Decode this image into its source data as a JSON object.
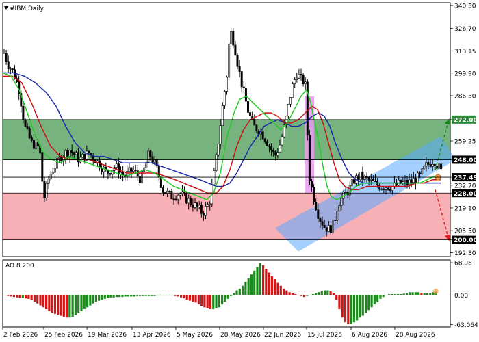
{
  "chart_title": "#IBM,Daily",
  "ao_label": "AO 8.200",
  "colors": {
    "grid_line": "#000000",
    "green_zone": "#2e8b3a",
    "red_zone": "#f47c87",
    "channel": "#5aa9ff",
    "pink_bar": "#e79bf0",
    "ma_fast": "#22cc22",
    "ma_mid": "#cc1111",
    "ma_slow": "#1c2aa8",
    "ao_up": "#1a8a1a",
    "ao_down": "#d41515",
    "arrow_up": "#1a8a1a",
    "arrow_down": "#e02020"
  },
  "chart_data": [
    {
      "type": "candlestick",
      "title": "#IBM,Daily",
      "x_ticks": [
        "2 Feb 2026",
        "25 Feb 2026",
        "19 Mar 2026",
        "13 Apr 2026",
        "5 May 2026",
        "28 May 2026",
        "22 Jun 2026",
        "15 Jul 2026",
        "6 Aug 2026",
        "28 Aug 2026"
      ],
      "y_ticks": [
        "340.30",
        "326.70",
        "313.15",
        "299.90",
        "286.30",
        "272.00",
        "259.25",
        "248.00",
        "237.49",
        "232.70",
        "228.00",
        "219.10",
        "205.50",
        "200.00",
        "192.30"
      ],
      "ylim": [
        190,
        342
      ],
      "levels": [
        {
          "label": "272.00",
          "value": 272.0,
          "style": "green"
        },
        {
          "label": "248.00",
          "value": 248.0,
          "style": "dark"
        },
        {
          "label": "237.49",
          "value": 237.49,
          "style": "dark"
        },
        {
          "label": "228.00",
          "value": 228.0,
          "style": "dark"
        },
        {
          "label": "200.00",
          "value": 200.0,
          "style": "dark"
        }
      ],
      "zones": {
        "resistance": [
          248,
          272
        ],
        "support": [
          200,
          228
        ]
      },
      "close_path": [
        [
          0,
          312
        ],
        [
          6,
          305
        ],
        [
          14,
          300
        ],
        [
          22,
          290
        ],
        [
          30,
          268
        ],
        [
          40,
          258
        ],
        [
          52,
          255
        ],
        [
          58,
          224
        ],
        [
          66,
          238
        ],
        [
          74,
          244
        ],
        [
          84,
          250
        ],
        [
          96,
          254
        ],
        [
          110,
          248
        ],
        [
          124,
          252
        ],
        [
          138,
          246
        ],
        [
          150,
          240
        ],
        [
          162,
          244
        ],
        [
          176,
          238
        ],
        [
          188,
          242
        ],
        [
          200,
          236
        ],
        [
          212,
          252
        ],
        [
          222,
          244
        ],
        [
          232,
          230
        ],
        [
          244,
          226
        ],
        [
          256,
          228
        ],
        [
          268,
          224
        ],
        [
          280,
          220
        ],
        [
          290,
          216
        ],
        [
          300,
          222
        ],
        [
          308,
          242
        ],
        [
          314,
          262
        ],
        [
          320,
          282
        ],
        [
          326,
          300
        ],
        [
          330,
          326
        ],
        [
          336,
          318
        ],
        [
          342,
          304
        ],
        [
          348,
          292
        ],
        [
          356,
          278
        ],
        [
          364,
          268
        ],
        [
          372,
          266
        ],
        [
          380,
          262
        ],
        [
          388,
          256
        ],
        [
          396,
          250
        ],
        [
          404,
          258
        ],
        [
          412,
          272
        ],
        [
          420,
          290
        ],
        [
          428,
          300
        ],
        [
          434,
          296
        ],
        [
          440,
          294
        ],
        [
          446,
          238
        ],
        [
          452,
          226
        ],
        [
          460,
          214
        ],
        [
          468,
          208
        ],
        [
          476,
          206
        ],
        [
          482,
          210
        ],
        [
          488,
          222
        ],
        [
          496,
          226
        ],
        [
          504,
          230
        ],
        [
          512,
          236
        ],
        [
          520,
          238
        ],
        [
          530,
          236
        ],
        [
          540,
          234
        ],
        [
          550,
          232
        ],
        [
          560,
          232
        ],
        [
          570,
          232
        ],
        [
          580,
          234
        ],
        [
          590,
          234
        ],
        [
          600,
          236
        ],
        [
          608,
          238
        ],
        [
          616,
          244
        ],
        [
          622,
          246
        ],
        [
          628,
          248
        ],
        [
          634,
          244
        ],
        [
          640,
          240
        ]
      ],
      "ma_fast": [
        [
          0,
          300
        ],
        [
          12,
          298
        ],
        [
          24,
          290
        ],
        [
          36,
          276
        ],
        [
          48,
          262
        ],
        [
          60,
          252
        ],
        [
          72,
          248
        ],
        [
          84,
          246
        ],
        [
          96,
          250
        ],
        [
          110,
          248
        ],
        [
          124,
          246
        ],
        [
          138,
          244
        ],
        [
          152,
          242
        ],
        [
          166,
          240
        ],
        [
          180,
          238
        ],
        [
          194,
          240
        ],
        [
          208,
          242
        ],
        [
          222,
          240
        ],
        [
          236,
          236
        ],
        [
          250,
          232
        ],
        [
          262,
          230
        ],
        [
          274,
          228
        ],
        [
          286,
          226
        ],
        [
          298,
          224
        ],
        [
          308,
          228
        ],
        [
          318,
          240
        ],
        [
          328,
          262
        ],
        [
          338,
          276
        ],
        [
          346,
          284
        ],
        [
          356,
          286
        ],
        [
          366,
          282
        ],
        [
          376,
          278
        ],
        [
          386,
          274
        ],
        [
          396,
          270
        ],
        [
          406,
          266
        ],
        [
          416,
          270
        ],
        [
          426,
          278
        ],
        [
          436,
          286
        ],
        [
          444,
          290
        ],
        [
          450,
          282
        ],
        [
          456,
          270
        ],
        [
          462,
          258
        ],
        [
          468,
          244
        ],
        [
          474,
          232
        ],
        [
          480,
          226
        ],
        [
          488,
          224
        ],
        [
          496,
          226
        ],
        [
          506,
          228
        ],
        [
          516,
          232
        ],
        [
          526,
          234
        ],
        [
          538,
          234
        ],
        [
          550,
          234
        ],
        [
          562,
          234
        ],
        [
          574,
          234
        ],
        [
          586,
          234
        ],
        [
          598,
          234
        ],
        [
          610,
          234
        ],
        [
          620,
          236
        ],
        [
          630,
          238
        ],
        [
          640,
          238
        ]
      ],
      "ma_mid": [
        [
          0,
          298
        ],
        [
          14,
          298
        ],
        [
          28,
          294
        ],
        [
          42,
          282
        ],
        [
          56,
          268
        ],
        [
          70,
          256
        ],
        [
          84,
          250
        ],
        [
          98,
          248
        ],
        [
          112,
          248
        ],
        [
          126,
          248
        ],
        [
          140,
          246
        ],
        [
          154,
          244
        ],
        [
          168,
          242
        ],
        [
          182,
          240
        ],
        [
          196,
          240
        ],
        [
          210,
          240
        ],
        [
          224,
          240
        ],
        [
          238,
          238
        ],
        [
          252,
          236
        ],
        [
          264,
          234
        ],
        [
          276,
          232
        ],
        [
          288,
          230
        ],
        [
          300,
          228
        ],
        [
          312,
          228
        ],
        [
          322,
          232
        ],
        [
          332,
          242
        ],
        [
          342,
          256
        ],
        [
          352,
          266
        ],
        [
          362,
          272
        ],
        [
          372,
          274
        ],
        [
          382,
          276
        ],
        [
          392,
          276
        ],
        [
          402,
          274
        ],
        [
          412,
          270
        ],
        [
          422,
          270
        ],
        [
          432,
          272
        ],
        [
          442,
          276
        ],
        [
          452,
          280
        ],
        [
          460,
          278
        ],
        [
          468,
          270
        ],
        [
          476,
          258
        ],
        [
          484,
          246
        ],
        [
          492,
          236
        ],
        [
          500,
          232
        ],
        [
          510,
          230
        ],
        [
          520,
          230
        ],
        [
          532,
          232
        ],
        [
          544,
          232
        ],
        [
          556,
          232
        ],
        [
          568,
          232
        ],
        [
          580,
          232
        ],
        [
          592,
          232
        ],
        [
          604,
          234
        ],
        [
          616,
          234
        ],
        [
          628,
          236
        ],
        [
          640,
          236
        ]
      ],
      "ma_slow": [
        [
          0,
          300
        ],
        [
          16,
          300
        ],
        [
          32,
          298
        ],
        [
          48,
          294
        ],
        [
          64,
          288
        ],
        [
          78,
          280
        ],
        [
          92,
          268
        ],
        [
          106,
          258
        ],
        [
          120,
          252
        ],
        [
          134,
          250
        ],
        [
          148,
          250
        ],
        [
          162,
          248
        ],
        [
          176,
          246
        ],
        [
          190,
          246
        ],
        [
          204,
          246
        ],
        [
          218,
          246
        ],
        [
          232,
          244
        ],
        [
          246,
          242
        ],
        [
          260,
          240
        ],
        [
          274,
          238
        ],
        [
          288,
          236
        ],
        [
          300,
          234
        ],
        [
          312,
          232
        ],
        [
          322,
          232
        ],
        [
          332,
          234
        ],
        [
          342,
          240
        ],
        [
          352,
          248
        ],
        [
          362,
          256
        ],
        [
          372,
          262
        ],
        [
          382,
          268
        ],
        [
          392,
          270
        ],
        [
          402,
          272
        ],
        [
          412,
          270
        ],
        [
          422,
          268
        ],
        [
          432,
          268
        ],
        [
          442,
          270
        ],
        [
          452,
          274
        ],
        [
          462,
          276
        ],
        [
          470,
          274
        ],
        [
          478,
          268
        ],
        [
          486,
          258
        ],
        [
          496,
          248
        ],
        [
          506,
          240
        ],
        [
          516,
          236
        ],
        [
          528,
          234
        ],
        [
          540,
          234
        ],
        [
          552,
          234
        ],
        [
          564,
          234
        ],
        [
          576,
          234
        ],
        [
          588,
          234
        ],
        [
          600,
          234
        ],
        [
          612,
          234
        ],
        [
          624,
          234
        ],
        [
          634,
          234
        ],
        [
          640,
          234
        ]
      ],
      "channel": {
        "start": [
          [
            398,
            207
          ],
          [
            432,
            193
          ]
        ],
        "end": [
          [
            640,
            262
          ],
          [
            662,
            248
          ]
        ]
      },
      "pink_bar": {
        "x_from": 441,
        "x_to": 455,
        "y_from": 228,
        "y_to": 286
      },
      "arrow_up": {
        "from": [
          632,
          242
        ],
        "to": [
          652,
          272
        ]
      },
      "arrow_down": {
        "from": [
          632,
          230
        ],
        "to": [
          652,
          200
        ]
      },
      "current_marker": {
        "x": 636,
        "y": 237.49
      }
    },
    {
      "type": "bar",
      "title": "AO 8.200",
      "y_ticks": [
        "68.98",
        "0.00",
        "-63.064"
      ],
      "ylim": [
        -68,
        75
      ],
      "values": [
        0,
        -2,
        -3,
        -4,
        -5,
        -6,
        -6,
        -7,
        -8,
        -10,
        -14,
        -18,
        -22,
        -26,
        -30,
        -34,
        -38,
        -40,
        -42,
        -44,
        -46,
        -48,
        -48,
        -46,
        -42,
        -38,
        -34,
        -30,
        -26,
        -22,
        -18,
        -14,
        -12,
        -10,
        -8,
        -6,
        -5,
        -5,
        -4,
        -4,
        -4,
        -3,
        -3,
        -3,
        -3,
        -2,
        -2,
        -2,
        -2,
        -2,
        -2,
        -2,
        -1,
        -1,
        -1,
        -1,
        -1,
        -1,
        -2,
        -3,
        -5,
        -7,
        -10,
        -12,
        -14,
        -16,
        -20,
        -24,
        -26,
        -28,
        -30,
        -30,
        -28,
        -26,
        -20,
        -14,
        -8,
        -2,
        4,
        10,
        14,
        20,
        28,
        36,
        44,
        52,
        60,
        68,
        64,
        56,
        48,
        40,
        34,
        26,
        20,
        14,
        10,
        6,
        4,
        2,
        0,
        -2,
        -4,
        -2,
        0,
        2,
        4,
        6,
        8,
        10,
        10,
        8,
        4,
        -10,
        -30,
        -48,
        -58,
        -62,
        -62,
        -58,
        -54,
        -48,
        -44,
        -38,
        -32,
        -26,
        -20,
        -14,
        -8,
        -4,
        0,
        2,
        2,
        2,
        2,
        2,
        3,
        4,
        6,
        6,
        6,
        6,
        4,
        4,
        4,
        4,
        6,
        8
      ]
    }
  ]
}
